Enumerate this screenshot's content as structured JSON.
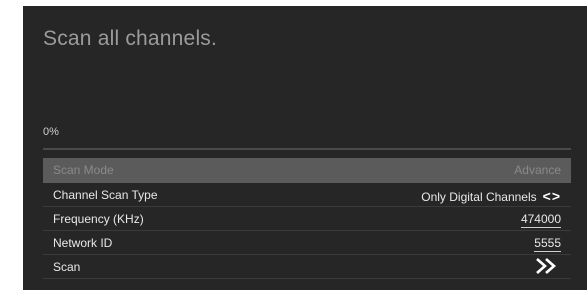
{
  "screen": {
    "title": "Scan all channels."
  },
  "progress": {
    "label": "0%",
    "fraction": 0
  },
  "menu": {
    "items": [
      {
        "label": "Scan Mode",
        "value": "Advance"
      },
      {
        "label": "Channel Scan Type",
        "value": "Only Digital Channels",
        "icon": "left-right-arrows-icon"
      },
      {
        "label": "Frequency (KHz)",
        "value": "474000"
      },
      {
        "label": "Network ID",
        "value": "5555"
      },
      {
        "label": "Scan",
        "icon": "double-chevron-right-icon"
      }
    ]
  },
  "colors": {
    "panel": "#262626",
    "highlight": "#5b5b5b",
    "text": "#e8e8e8",
    "muted": "#8a8a8a"
  }
}
